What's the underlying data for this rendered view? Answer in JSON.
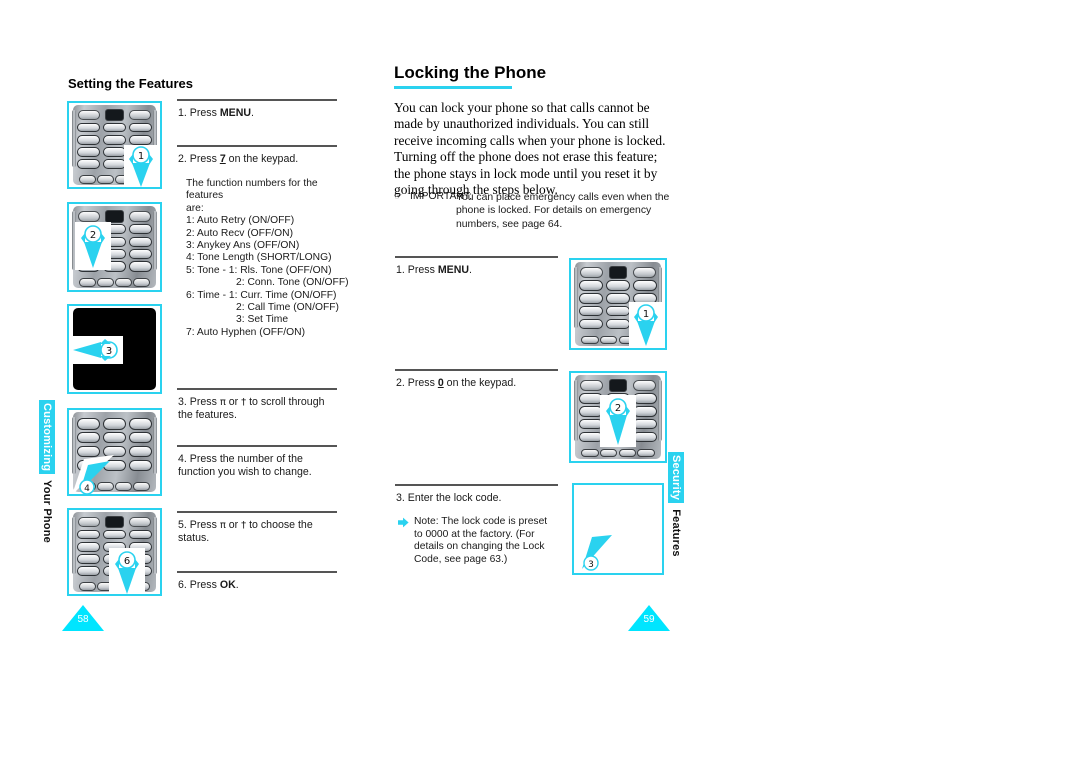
{
  "document": {
    "type": "user-manual-spread",
    "accent_color": "#2ad2ef",
    "page_numbers": {
      "left": "58",
      "right": "59"
    }
  },
  "left_page": {
    "heading": "Setting the Features",
    "side_tab": {
      "highlight": "Customizing",
      "plain": " Your Phone"
    },
    "steps": [
      {
        "num": "1.",
        "text_before": "Press ",
        "bold": "MENU",
        "text_after": "."
      },
      {
        "num": "2.",
        "text_before": "Press ",
        "bold": "7",
        "text_after": " on the keypad."
      },
      {
        "num": "3.",
        "text_before": "Press ",
        "bold": "",
        "text_after": " or  to scroll through the features."
      },
      {
        "num": "4.",
        "text_before": "Press the number of the function you wish to change.",
        "bold": "",
        "text_after": ""
      },
      {
        "num": "5.",
        "text_before": "Press ",
        "bold": "",
        "text_after": " or  to choose the status."
      },
      {
        "num": "6.",
        "text_before": "Press ",
        "bold": "OK",
        "text_after": "."
      }
    ],
    "function_list": {
      "intro_line1": "The function numbers for the features",
      "intro_line2": "are:",
      "items": [
        {
          "indent": 1,
          "text": "1: Auto Retry (ON/OFF)"
        },
        {
          "indent": 1,
          "text": "2: Auto Recv (OFF/ON)"
        },
        {
          "indent": 1,
          "text": "3: Anykey Ans (OFF/ON)"
        },
        {
          "indent": 1,
          "text": "4: Tone Length (SHORT/LONG)"
        },
        {
          "indent": 1,
          "text": "5: Tone - 1: Rls. Tone (OFF/ON)"
        },
        {
          "indent": 2,
          "text": "2: Conn. Tone (ON/OFF)"
        },
        {
          "indent": 1,
          "text": "6: Time - 1: Curr. Time (ON/OFF)"
        },
        {
          "indent": 2,
          "text": "2: Call Time (ON/OFF)"
        },
        {
          "indent": 3,
          "text": "3: Set Time"
        },
        {
          "indent": 1,
          "text": "7: Auto Hyphen (OFF/ON)"
        }
      ]
    },
    "figures": [
      {
        "label": "1",
        "style": "keypad",
        "arrow": "down-right",
        "caption": "phone keypad with callout 1"
      },
      {
        "label": "2",
        "style": "keypad",
        "arrow": "down-left",
        "caption": "phone keypad with callout 2"
      },
      {
        "label": "3",
        "style": "dark",
        "arrow": "left",
        "caption": "phone display with callout 3"
      },
      {
        "label": "4",
        "style": "keypad",
        "arrow": "up-right",
        "caption": "phone keypad with callout 4"
      },
      {
        "label": "6",
        "style": "keypad",
        "arrow": "down",
        "caption": "phone keypad with callout 6"
      }
    ]
  },
  "right_page": {
    "heading": "Locking the Phone",
    "side_tab": {
      "highlight": "Security",
      "plain": " Features"
    },
    "intro": "You can lock your phone so that calls cannot be made by unauthorized individuals. You can still receive incoming calls when your phone is locked. Turning off the phone does not erase this feature; the phone stays in lock mode until you reset it by going through the steps below.",
    "important": {
      "icon": "pointing-hand-icon",
      "label": "IMPORTANT:",
      "body": "You can place emergency calls even when the phone is locked. For details on emergency numbers, see page 64."
    },
    "steps": [
      {
        "num": "1.",
        "text_before": "Press ",
        "bold": "MENU",
        "text_after": "."
      },
      {
        "num": "2.",
        "text_before": "Press ",
        "bold": "0",
        "text_after": " on the keypad."
      },
      {
        "num": "3.",
        "text_before": "Enter the lock code.",
        "bold": "",
        "text_after": ""
      }
    ],
    "note": {
      "icon": "cyan-arrow-icon",
      "text": "Note: The lock code is preset to 0000 at the factory. (For details on changing the Lock Code, see page 63.)"
    },
    "figures": [
      {
        "label": "1",
        "style": "keypad",
        "arrow": "down-right",
        "caption": "phone keypad with callout 1"
      },
      {
        "label": "2",
        "style": "keypad",
        "arrow": "down",
        "caption": "phone keypad with callout 2"
      },
      {
        "label": "3",
        "style": "blank",
        "arrow": "up-left",
        "caption": "blank phone display with callout 3"
      }
    ]
  }
}
